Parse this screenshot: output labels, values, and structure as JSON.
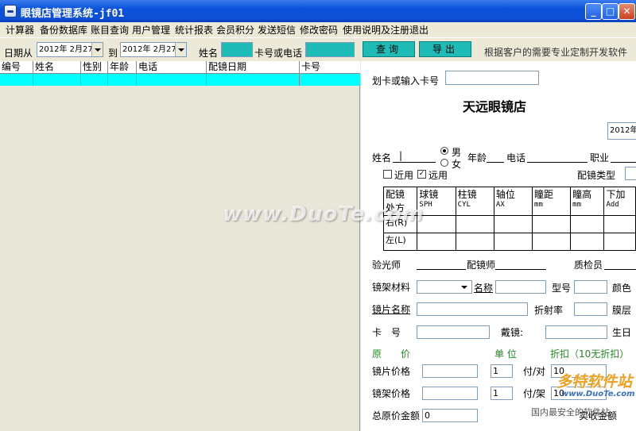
{
  "window": {
    "title": "眼镜店管理系统-jf01",
    "min": "_",
    "max": "□",
    "close": "✕"
  },
  "menu": [
    "计算器",
    "备份数据库",
    "账目查询",
    "用户管理",
    "统计报表",
    "会员积分",
    "发送短信",
    "修改密码",
    "使用说明及注册",
    "退出"
  ],
  "toolbar": {
    "date_from_label": "日期从",
    "date_from": "2012年 2月27",
    "to_label": "到",
    "date_to": "2012年 2月27",
    "name_label": "姓名",
    "card_label": "卡号或电话",
    "query_button": "查询",
    "export_button": "导出",
    "tagline": "根据客户的需要专业定制开发软件"
  },
  "table": {
    "columns": [
      "编号",
      "姓名",
      "性别",
      "年龄",
      "电话",
      "配镜日期",
      "卡号"
    ]
  },
  "form": {
    "card_prompt": "划卡或输入卡号",
    "shop_name": "天远眼镜店",
    "date": "2012年",
    "name_label": "姓名",
    "name_value": "|",
    "male": "男",
    "female": "女",
    "age_label": "年龄",
    "phone_label": "电话",
    "job_label": "职业",
    "near": "近用",
    "far": "远用",
    "type_label": "配镜类型",
    "rx": {
      "corner_a": "配镜",
      "corner_b": "处方",
      "cols": [
        {
          "main": "球镜",
          "sub": "SPH"
        },
        {
          "main": "柱镜",
          "sub": "CYL"
        },
        {
          "main": "轴位",
          "sub": "AX"
        },
        {
          "main": "瞳距",
          "sub": "mm"
        },
        {
          "main": "瞳高",
          "sub": "mm"
        },
        {
          "main": "下加",
          "sub": "Add"
        }
      ],
      "right": "右(R)",
      "left": "左(L)"
    },
    "optometrist": "验光师",
    "fitter": "配镜师",
    "inspector": "质检员",
    "frame_material": "镜架材料",
    "model_name": "名称",
    "model_no": "型号",
    "color": "颜色",
    "lens_name": "镜片名称",
    "refractive": "折射率",
    "coating": "膜层",
    "card_no": "卡　号",
    "wearer": "戴镜:",
    "birthday": "生日",
    "orig_price": "原　　价",
    "unit_price": "单 位",
    "discount": "折扣（10无折扣）",
    "lens_price": "镜片价格",
    "frame_price": "镜架价格",
    "qty1": "1",
    "qty2": "1",
    "unit1": "付/对",
    "unit2": "付/架",
    "disc1": "10",
    "disc2": "10",
    "total_label": "总原价金额",
    "total_value": "0",
    "paid_label": "实收金额"
  },
  "watermark": {
    "main": "www.DuoTe.com",
    "brand": "多特软件站",
    "brand_url": "www.DuoTe.com",
    "brand_sub": "国内最安全的软件站"
  }
}
